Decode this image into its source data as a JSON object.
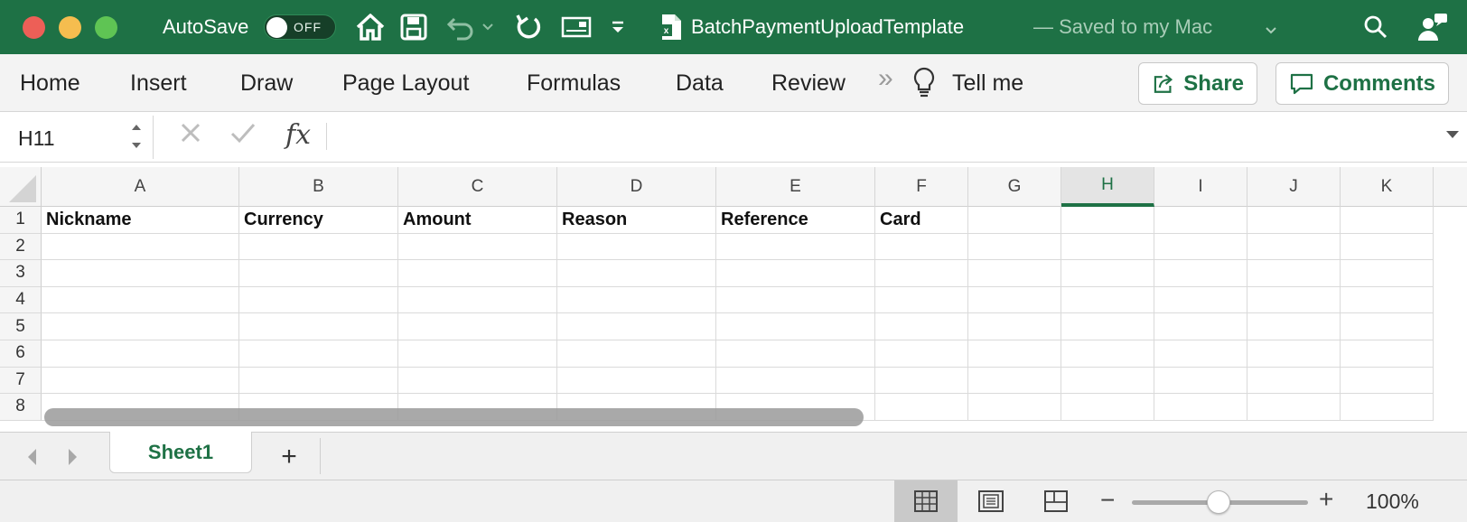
{
  "titlebar": {
    "autosave_label": "AutoSave",
    "autosave_state": "OFF",
    "doc_title": "BatchPaymentUploadTemplate",
    "doc_status": "— Saved to my Mac",
    "accent": "#1e7145"
  },
  "ribbon": {
    "tabs": [
      "Home",
      "Insert",
      "Draw",
      "Page Layout",
      "Formulas",
      "Data",
      "Review"
    ],
    "overflow": "»",
    "tell_me": "Tell me",
    "share_label": "Share",
    "comments_label": "Comments"
  },
  "formula_bar": {
    "name_box": "H11",
    "fx": "fx",
    "formula": ""
  },
  "grid": {
    "columns": [
      "A",
      "B",
      "C",
      "D",
      "E",
      "F",
      "G",
      "H",
      "I",
      "J",
      "K"
    ],
    "selected_column": "H",
    "rows": [
      "1",
      "2",
      "3",
      "4",
      "5",
      "6",
      "7",
      "8"
    ],
    "header_row": [
      "Nickname",
      "Currency",
      "Amount",
      "Reason",
      "Reference",
      "Card"
    ]
  },
  "sheets": {
    "tabs": [
      "Sheet1"
    ],
    "add": "+"
  },
  "statusbar": {
    "zoom_minus": "−",
    "zoom_plus": "+",
    "zoom": "100%",
    "zoom_level_percent": 100
  }
}
